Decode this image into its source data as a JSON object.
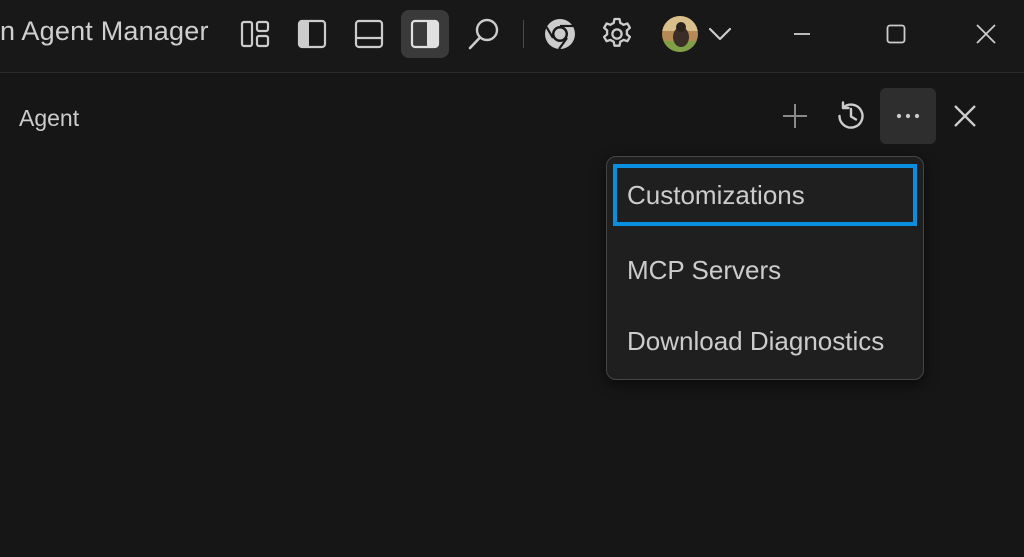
{
  "titlebar": {
    "title": "n Agent Manager",
    "icons": [
      "customize-layout-icon",
      "toggle-primary-sidebar-icon",
      "toggle-panel-icon",
      "toggle-secondary-sidebar-icon",
      "search-icon",
      "chrome-icon",
      "gear-icon",
      "avatar",
      "chevron-down-icon"
    ],
    "window_controls": [
      "minimize-icon",
      "maximize-icon",
      "close-icon"
    ]
  },
  "panel": {
    "title": "Agent",
    "actions": [
      "plus-icon",
      "history-icon",
      "more-icon",
      "close-icon"
    ]
  },
  "menu": {
    "items": [
      {
        "label": "Customizations",
        "focused": true
      },
      {
        "label": "MCP Servers",
        "focused": false
      },
      {
        "label": "Download Diagnostics",
        "focused": false
      }
    ]
  },
  "colors": {
    "background": "#161616",
    "focus_ring": "#0a8fe0",
    "icon": "#cccccc"
  }
}
